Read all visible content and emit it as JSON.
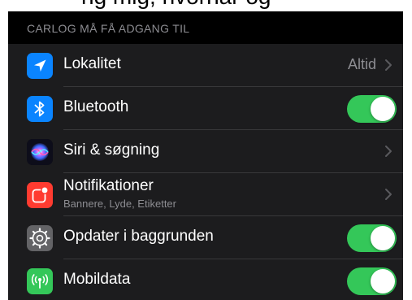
{
  "top_fragment": "ng mig, hvornår og",
  "section": {
    "header": "CARLOG MÅ FÅ ADGANG TIL"
  },
  "colors": {
    "location_icon_bg": "#0a84ff",
    "bluetooth_icon_bg": "#0a84ff",
    "notifications_icon_bg": "#ff3b30",
    "background_refresh_icon_bg": "#636366",
    "mobile_data_icon_bg": "#34c759",
    "toggle_on": "#34c759"
  },
  "rows": [
    {
      "icon": "location-arrow-icon",
      "label": "Lokalitet",
      "value": "Altid",
      "control": "chevron"
    },
    {
      "icon": "bluetooth-icon",
      "label": "Bluetooth",
      "control": "toggle",
      "on": true
    },
    {
      "icon": "siri-icon",
      "label": "Siri & søgning",
      "control": "chevron"
    },
    {
      "icon": "notifications-icon",
      "label": "Notifikationer",
      "sublabel": "Bannere, Lyde, Etiketter",
      "control": "chevron"
    },
    {
      "icon": "gear-icon",
      "label": "Opdater i baggrunden",
      "control": "toggle",
      "on": true
    },
    {
      "icon": "antenna-icon",
      "label": "Mobildata",
      "control": "toggle",
      "on": true
    }
  ]
}
